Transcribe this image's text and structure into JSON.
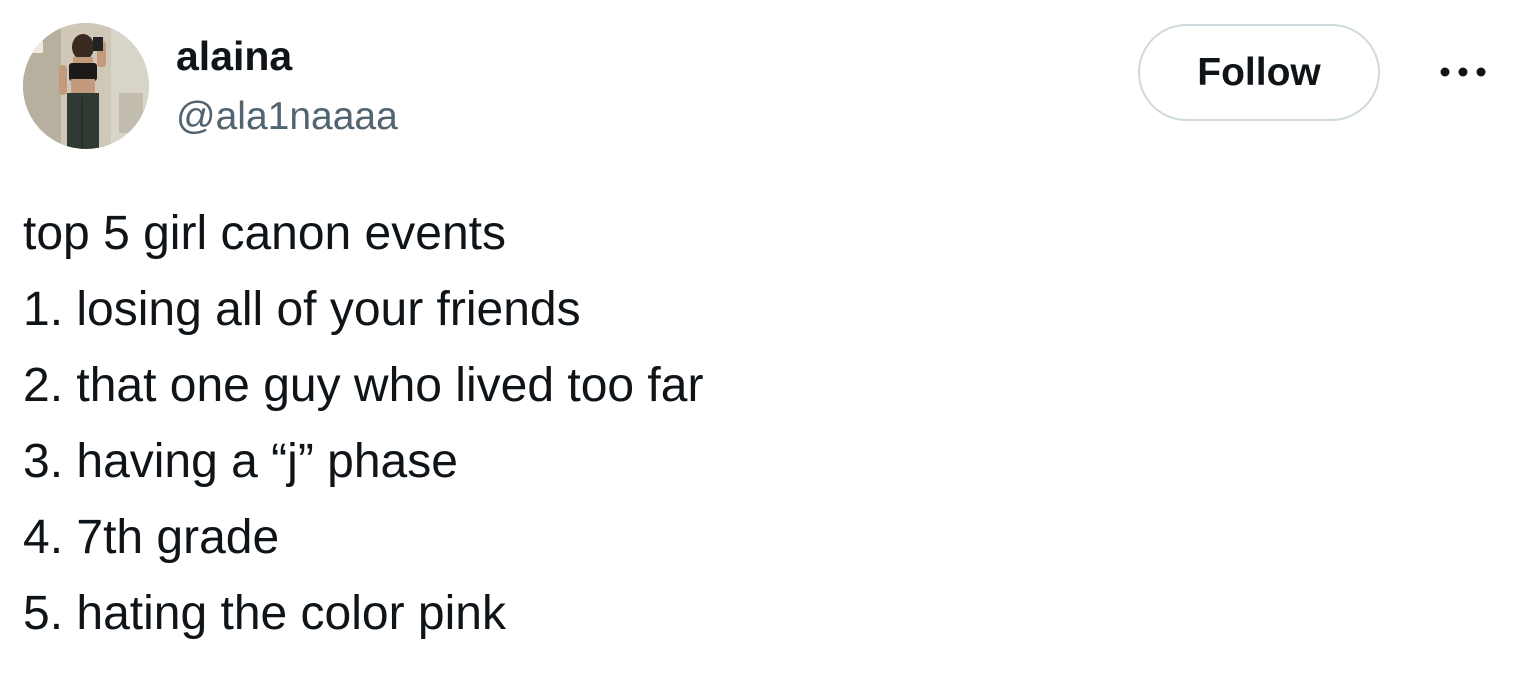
{
  "author": {
    "display_name": "alaina",
    "handle": "@ala1naaaa"
  },
  "actions": {
    "follow_label": "Follow",
    "more_icon": "ellipsis-icon"
  },
  "tweet": {
    "lines": [
      "top 5 girl canon events",
      "1. losing all of your friends",
      "2. that one guy who lived too far",
      "3. having a “j” phase",
      "4. 7th grade",
      "5. hating the color pink"
    ]
  },
  "colors": {
    "text_primary": "#0f1419",
    "text_secondary": "#536471",
    "button_border": "#cfd9de",
    "background": "#ffffff"
  }
}
